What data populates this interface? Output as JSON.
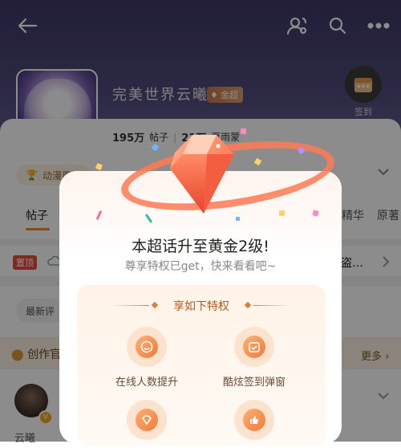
{
  "header": {
    "icons": [
      "back-arrow-icon",
      "people-settings-icon",
      "search-icon",
      "more-dots-icon"
    ]
  },
  "profile": {
    "name": "完美世界云曦",
    "level_badge": "金超",
    "sign_label": "签到",
    "stats": {
      "posts_count": "195万",
      "posts_label": "帖子",
      "fans_count": "21万",
      "fans_label": "夏雨蒙"
    },
    "rank_chip": "动漫周榜"
  },
  "tabs": [
    "帖子",
    "精华",
    "原著"
  ],
  "pinned": {
    "badge": "置顶",
    "more_text": "盗…"
  },
  "filter": {
    "latest": "最新评"
  },
  "merit": {
    "title": "创作官",
    "more": "更多"
  },
  "user": {
    "name": "云曦"
  },
  "modal": {
    "title": "本超话升至黄金2级!",
    "subtitle": "尊享特权已get，快来看看吧~",
    "panel_title": "享如下特权",
    "perks": [
      {
        "label": "在线人数提升",
        "icon": "smile-icon"
      },
      {
        "label": "酷炫签到弹窗",
        "icon": "calendar-check-icon"
      },
      {
        "label": "",
        "icon": "diamond-icon"
      },
      {
        "label": "",
        "icon": "thumbs-up-icon"
      }
    ]
  },
  "colors": {
    "accent": "#f07a3d",
    "hero": "#4a4476",
    "panel": "#fff3e8"
  }
}
